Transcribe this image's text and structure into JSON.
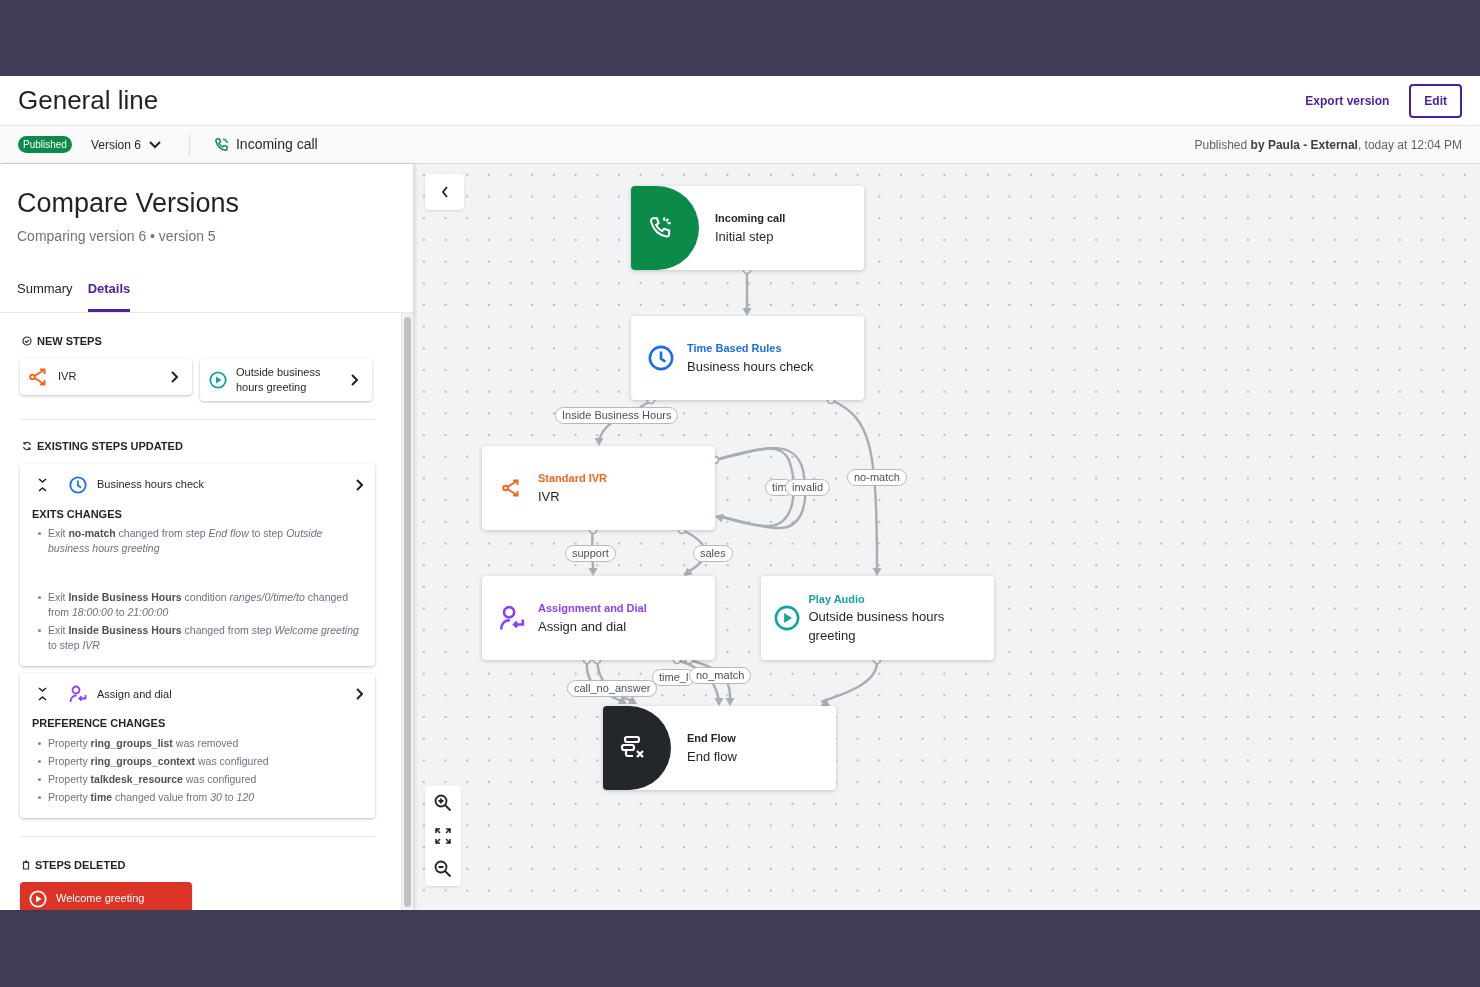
{
  "header": {
    "title": "General line",
    "actions": [
      {
        "kind": "link",
        "label": "Export version"
      },
      {
        "kind": "outline",
        "label": "Edit"
      }
    ]
  },
  "toolbar": {
    "status": "Published",
    "version": "Version 6",
    "trigger": "Incoming call",
    "published_info": "Published **by Paula - External**, today at 12:04 PM"
  },
  "panel": {
    "title": "Compare Versions",
    "subtitle": "Comparing version 6 • version 5",
    "tabs": [
      {
        "label": "Summary",
        "selected": false
      },
      {
        "label": "Details",
        "selected": true
      }
    ],
    "sections": [
      {
        "kind": "new",
        "heading": "NEW STEPS",
        "steps": [
          {
            "kind": "ivr",
            "label": "IVR"
          },
          {
            "kind": "play",
            "label": "Outside business hours greeting"
          }
        ]
      },
      {
        "kind": "updated",
        "heading": "EXISTING STEPS UPDATED",
        "steps": [
          {
            "kind": "clock",
            "label": "Business hours check",
            "group_title": "EXITS CHANGES",
            "changes": [
              "Exit **no-match** changed from step *End flow* to step *Outside business hours greeting*",
              "Exit **Inside Business Hours** condition *ranges/0/time/to* changed from *18:00:00* to *21:00:00*",
              "Exit **Inside Business Hours** changed from step *Welcome greeting* to step *IVR*"
            ]
          },
          {
            "kind": "assign",
            "label": "Assign and dial",
            "group_title": "PREFERENCE CHANGES",
            "changes": [
              "Property **ring_groups_list** was removed",
              "Property **ring_groups_context** was configured",
              "Property **talkdesk_resource** was configured",
              "Property **time** changed value from *30* to *120*"
            ]
          }
        ]
      },
      {
        "kind": "deleted",
        "heading": "STEPS DELETED",
        "steps": [
          {
            "kind": "play",
            "label": "Welcome greeting"
          }
        ]
      }
    ]
  },
  "canvas": {
    "nodes": [
      {
        "kind": "incoming",
        "category": "Incoming call",
        "title": "Initial step"
      },
      {
        "kind": "clock",
        "category": "Time Based Rules",
        "title": "Business hours check"
      },
      {
        "kind": "ivr",
        "category": "Standard IVR",
        "title": "IVR"
      },
      {
        "kind": "assign",
        "category": "Assignment and Dial",
        "title": "Assign and dial"
      },
      {
        "kind": "play",
        "category": "Play Audio",
        "title": "Outside business hours greeting"
      },
      {
        "kind": "end",
        "category": "End Flow",
        "title": "End flow"
      }
    ],
    "edge_labels": [
      "Inside Business Hours",
      "tim",
      "invalid",
      "no-match",
      "support",
      "sales",
      "call_no_answer",
      "time_l",
      "no_match"
    ]
  }
}
